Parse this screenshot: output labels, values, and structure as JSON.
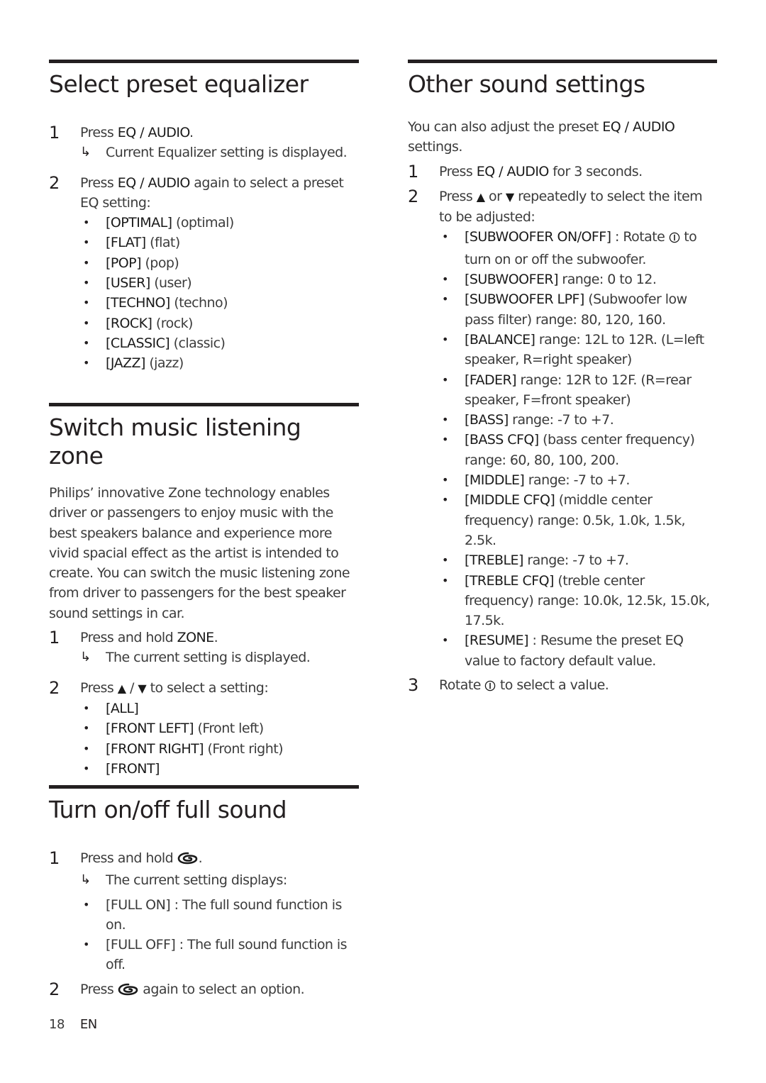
{
  "sections": {
    "eq": {
      "title": "Select preset equalizer",
      "step1": {
        "num": "1",
        "pre": "Press ",
        "kw": "EQ / AUDIO",
        "post": ".",
        "result": "Current Equalizer setting is displayed."
      },
      "step2": {
        "num": "2",
        "pre": "Press ",
        "kw": "EQ / AUDIO",
        "post": " again to select a preset EQ setting:"
      },
      "options": [
        {
          "kw": "[OPTIMAL]",
          "desc": " (optimal)"
        },
        {
          "kw": "[FLAT]",
          "desc": " (flat)"
        },
        {
          "kw": "[POP]",
          "desc": " (pop)"
        },
        {
          "kw": "[USER]",
          "desc": " (user)"
        },
        {
          "kw": "[TECHNO]",
          "desc": " (techno)"
        },
        {
          "kw": "[ROCK]",
          "desc": " (rock)"
        },
        {
          "kw": "[CLASSIC]",
          "desc": " (classic)"
        },
        {
          "kw": "[JAZZ]",
          "desc": " (jazz)"
        }
      ]
    },
    "zone": {
      "title": "Switch music listening zone",
      "intro": "Philips’ innovative Zone technology enables driver or passengers to enjoy music with the best speakers balance and experience more vivid spacial effect as the artist is intended to create. You can switch the music listening zone from driver to passengers for the best speaker sound settings in car.",
      "step1": {
        "num": "1",
        "pre": "Press and hold ",
        "kw": "ZONE",
        "post": ".",
        "result": "The current setting is displayed."
      },
      "step2": {
        "num": "2",
        "pre": "Press ",
        "up": "▲",
        "sep": " / ",
        "down": "▼",
        "post": " to select a setting:"
      },
      "options": [
        {
          "kw": "[ALL]",
          "desc": ""
        },
        {
          "kw": "[FRONT LEFT]",
          "desc": " (Front left)"
        },
        {
          "kw": "[FRONT RIGHT]",
          "desc": " (Front right)"
        },
        {
          "kw": "[FRONT]",
          "desc": ""
        }
      ]
    },
    "fullsound": {
      "title": "Turn on/off full sound",
      "step1": {
        "num": "1",
        "pre": "Press and hold ",
        "post": ".",
        "result": "The current setting displays:"
      },
      "options": [
        {
          "text": "[FULL ON] : The full sound function is on."
        },
        {
          "text": "[FULL OFF] : The full sound function is off."
        }
      ],
      "step2": {
        "num": "2",
        "pre": "Press ",
        "post": " again to select an option."
      }
    },
    "other": {
      "title": "Other sound settings",
      "intro_pre": "You can also adjust the preset ",
      "intro_kw": "EQ / AUDIO",
      "intro_post": " settings.",
      "step1": {
        "num": "1",
        "pre": "Press ",
        "kw": "EQ / AUDIO",
        "post": " for 3 seconds."
      },
      "step2": {
        "num": "2",
        "pre": "Press ",
        "up": "▲",
        "mid": " or ",
        "down": "▼",
        "post": " repeatedly to select the item to be adjusted:"
      },
      "items": [
        {
          "kw": "[SUBWOOFER ON/OFF]",
          "pre": " : Rotate ",
          "knob": true,
          "post": " to turn on or off the subwoofer."
        },
        {
          "kw": "[SUBWOOFER]",
          "pre": " range: 0 to 12."
        },
        {
          "kw": "[SUBWOOFER LPF]",
          "pre": " (Subwoofer low pass filter) range: 80, 120, 160."
        },
        {
          "kw": "[BALANCE]",
          "pre": " range: 12L to 12R. (L=left speaker, R=right speaker)"
        },
        {
          "kw": "[FADER]",
          "pre": " range: 12R to 12F. (R=rear speaker, F=front speaker)"
        },
        {
          "kw": "[BASS]",
          "pre": " range: -7 to +7."
        },
        {
          "kw": "[BASS CFQ]",
          "pre": " (bass center frequency) range: 60, 80, 100, 200."
        },
        {
          "kw": "[MIDDLE]",
          "pre": " range: -7 to +7."
        },
        {
          "kw": "[MIDDLE CFQ]",
          "pre": " (middle center frequency) range: 0.5k, 1.0k, 1.5k, 2.5k."
        },
        {
          "kw": "[TREBLE]",
          "pre": " range: -7 to +7."
        },
        {
          "kw": "[TREBLE CFQ]",
          "pre": " (treble center frequency) range: 10.0k, 12.5k, 15.0k, 17.5k."
        },
        {
          "kw": "[RESUME]",
          "pre": " : Resume the preset EQ value to factory default value."
        }
      ],
      "step3": {
        "num": "3",
        "pre": "Rotate ",
        "post": " to select a value."
      }
    }
  },
  "icons": {
    "result_arrow": "↳",
    "bullet": "•",
    "knob": "rotary-knob-icon",
    "fullsound": "full-sound-swirl-icon"
  },
  "footer": {
    "page": "18",
    "lang": "EN"
  },
  "colors": {
    "rule": "#231f20",
    "text": "#3b3b3b",
    "keyword": "#1a1a1a"
  }
}
